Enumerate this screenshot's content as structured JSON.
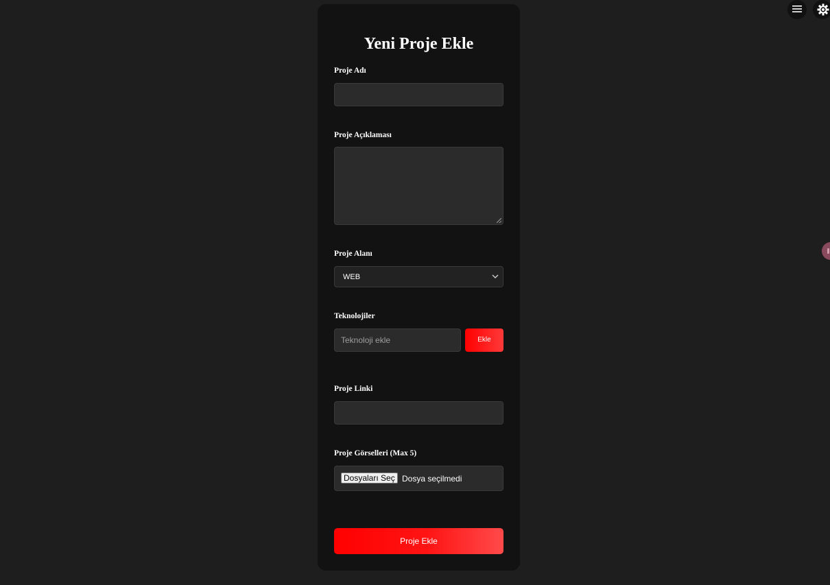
{
  "form": {
    "title": "Yeni Proje Ekle",
    "project_name": {
      "label": "Proje Adı",
      "value": ""
    },
    "project_description": {
      "label": "Proje Açıklaması",
      "value": ""
    },
    "project_area": {
      "label": "Proje Alanı",
      "selected": "WEB"
    },
    "technologies": {
      "label": "Teknolojiler",
      "placeholder": "Teknoloji ekle",
      "add_label": "Ekle"
    },
    "project_link": {
      "label": "Proje Linki",
      "value": ""
    },
    "project_images": {
      "label": "Proje Görselleri (Max 5)",
      "button_label": "Dosyaları Seç",
      "status": "Dosya seçilmedi"
    },
    "submit_label": "Proje Ekle"
  },
  "icons": {
    "menu": "menu-icon",
    "theme": "settings-icon",
    "side_tab": "side-tab-icon",
    "chevron": "chevron-down-icon"
  },
  "colors": {
    "page_background": "#1e1e1e",
    "card_background": "#121212",
    "input_background": "#2b2b2b",
    "accent_start": "#ff0000",
    "accent_end": "#ff4a4a"
  }
}
